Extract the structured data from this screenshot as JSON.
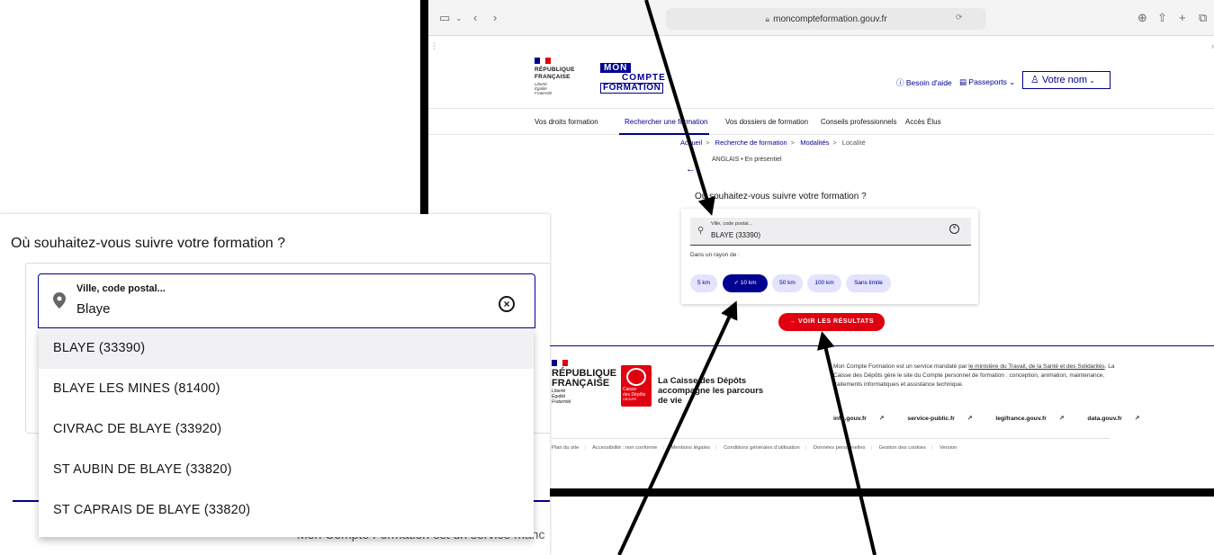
{
  "browser": {
    "url": "moncompteformation.gouv.fr",
    "left_icons": [
      "sidebar-icon",
      "chevron-down-icon",
      "back-icon",
      "forward-icon"
    ],
    "right_icons": [
      "download-icon",
      "share-icon",
      "new-tab-icon",
      "tabs-icon"
    ],
    "overflow_glyph": "»",
    "page_marker": "⋮"
  },
  "header": {
    "rf_logo": [
      "RÉPUBLIQUE",
      "FRANÇAISE"
    ],
    "rf_motto": [
      "Liberté",
      "Égalité",
      "Fraternité"
    ],
    "brand_logo": [
      "MON",
      "COMPTE",
      "FORMATION"
    ],
    "help_label": "Besoin d'aide",
    "passports_label": "Passeports",
    "user_label": "Votre nom"
  },
  "nav": {
    "items": [
      "Vos droits formation",
      "Rechercher une formation",
      "Vos dossiers de formation",
      "Conseils professionnels",
      "Accès Élus"
    ],
    "active_index": 1
  },
  "breadcrumb": {
    "items": [
      "Accueil",
      "Recherche de formation",
      "Modalités"
    ],
    "current": "Localité"
  },
  "course": {
    "label": "ANGLAIS • En présentiel"
  },
  "search": {
    "question": "Où souhaitez-vous suivre votre formation ?",
    "field_label": "Ville, code postal...",
    "value_selected": "BLAYE (33390)",
    "value_typed": "Blaye",
    "radius_label": "Dans un rayon de :",
    "radius_options": [
      "5 km",
      "10 km",
      "50 km",
      "100 km",
      "Sans limite"
    ],
    "radius_selected": "10 km",
    "submit_label": "VOIR LES RÉSULTATS",
    "suggestions": [
      "BLAYE (33390)",
      "BLAYE LES MINES (81400)",
      "CIVRAC DE BLAYE (33920)",
      "ST AUBIN DE BLAYE (33820)",
      "ST CAPRAIS DE BLAYE (33820)"
    ],
    "highlighted_index": 0
  },
  "footer": {
    "rf_logo": [
      "RÉPUBLIQUE",
      "FRANÇAISE"
    ],
    "rf_motto": [
      "Liberté",
      "Égalité",
      "Fraternité"
    ],
    "cdc_logo": [
      "Caisse",
      "des Dépôts",
      "GROUPE"
    ],
    "cdc_tagline": "La Caisse des Dépôts accompagne les parcours de vie",
    "text_before": "Mon Compte Formation est un service mandaté par ",
    "text_link1": "le ministère du Travail, de la Santé et des Solidarités",
    "text_after": ". La Caisse des Dépôts gère le site du Compte personnel de formation : conception, animation, maintenance, traitements informatiques et assistance technique.",
    "links": [
      "info.gouv.fr",
      "service-public.fr",
      "legifrance.gouv.fr",
      "data.gouv.fr"
    ],
    "bottom_links": [
      "Plan du site",
      "Accessibilité : non conforme",
      "Mentions légales",
      "Conditions générales d'utilisation",
      "Données personnelles",
      "Gestion des cookies",
      "Version"
    ]
  },
  "zoom_footer_text": "Mon Compte Formation est un service manc",
  "colors": {
    "blue": "#000091",
    "red": "#e1000f",
    "chip_bg": "#e3e3fd"
  }
}
